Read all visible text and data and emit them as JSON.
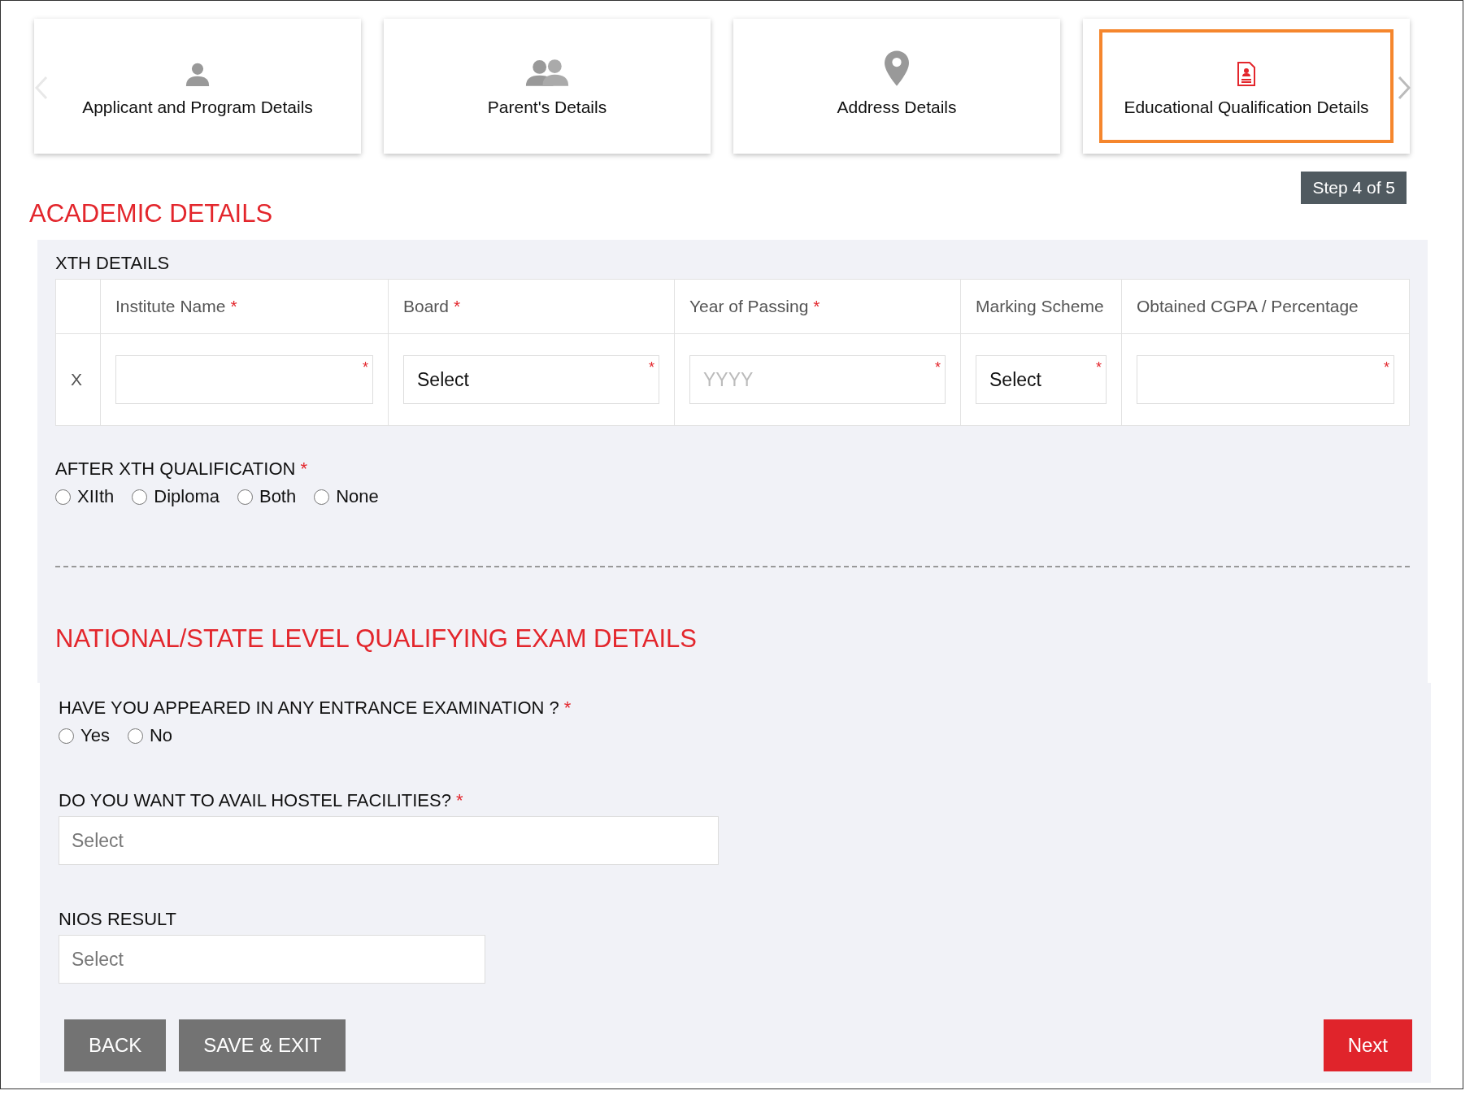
{
  "steps": [
    {
      "label": "Applicant and Program Details",
      "selected": false
    },
    {
      "label": "Parent's Details",
      "selected": false
    },
    {
      "label": "Address Details",
      "selected": false
    },
    {
      "label": "Educational Qualification Details",
      "selected": true
    }
  ],
  "step_indicator": "Step 4 of 5",
  "section_title": "ACADEMIC DETAILS",
  "xth": {
    "title": "XTH DETAILS",
    "columns": [
      {
        "label": "Institute Name",
        "required_mark": "*"
      },
      {
        "label": "Board",
        "required_mark": "*"
      },
      {
        "label": "Year of Passing",
        "required_mark": "*"
      },
      {
        "label": "Marking Scheme"
      },
      {
        "label": "Obtained CGPA / Percentage"
      }
    ],
    "row": {
      "label": "X",
      "cells": [
        {
          "kind": "text",
          "required_mark": "*"
        },
        {
          "kind": "select",
          "value": "Select",
          "required_mark": "*"
        },
        {
          "kind": "text",
          "placeholder": "YYYY",
          "required_mark": "*"
        },
        {
          "kind": "select",
          "value": "Select",
          "required_mark": "*"
        },
        {
          "kind": "text",
          "required_mark": "*"
        }
      ]
    }
  },
  "after_xth": {
    "label": "AFTER XTH QUALIFICATION",
    "required_mark": "*",
    "options": [
      {
        "label": "XIIth",
        "selected": false
      },
      {
        "label": "Diploma",
        "selected": false
      },
      {
        "label": "Both",
        "selected": false
      },
      {
        "label": "None",
        "selected": false
      }
    ]
  },
  "exam_title": "NATIONAL/STATE LEVEL QUALIFYING EXAM DETAILS",
  "entrance": {
    "label": "HAVE YOU APPEARED IN ANY ENTRANCE EXAMINATION ?",
    "required_mark": "*",
    "options": [
      {
        "label": "Yes",
        "selected": false
      },
      {
        "label": "No",
        "selected": false
      }
    ]
  },
  "hostel": {
    "label": "DO YOU WANT TO AVAIL HOSTEL FACILITIES?",
    "required_mark": "*",
    "placeholder": "Select"
  },
  "nios": {
    "label": "NIOS RESULT",
    "placeholder": "Select"
  },
  "buttons": [
    {
      "label": "BACK",
      "kind": "secondary"
    },
    {
      "label": "SAVE & EXIT",
      "kind": "secondary"
    },
    {
      "label": "Next",
      "kind": "primary"
    }
  ]
}
